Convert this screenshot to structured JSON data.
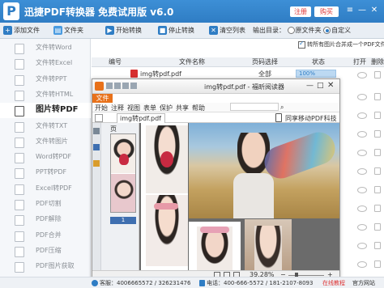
{
  "app": {
    "title": "迅捷PDF转换器 免费试用版 v6.0",
    "logo_letter": "P",
    "register_label": "注册",
    "buy_label": "购买",
    "window_buttons": [
      "≡",
      "—",
      "✕"
    ]
  },
  "toolbar": {
    "add_file": "添加文件",
    "add_folder": "文件夹",
    "start_convert": "开始转换",
    "stop_convert": "停止转换",
    "clear_list": "清空列表",
    "output_label": "输出目录：",
    "option_original": "原文件夹",
    "option_custom": "自定义"
  },
  "sidebar": {
    "items": [
      {
        "label": "文件转Word",
        "active": false
      },
      {
        "label": "文件转Excel",
        "active": false
      },
      {
        "label": "文件转PPT",
        "active": false
      },
      {
        "label": "文件转HTML",
        "active": false
      },
      {
        "label": "图片转PDF",
        "active": true
      },
      {
        "label": "文件转TXT",
        "active": false
      },
      {
        "label": "文件转图片",
        "active": false
      },
      {
        "label": "Word转PDF",
        "active": false
      },
      {
        "label": "PPT转PDF",
        "active": false
      },
      {
        "label": "Excel转PDF",
        "active": false
      },
      {
        "label": "PDF切割",
        "active": false
      },
      {
        "label": "PDF解除",
        "active": false
      },
      {
        "label": "PDF合并",
        "active": false
      },
      {
        "label": "PDF压缩",
        "active": false
      },
      {
        "label": "PDF图片获取",
        "active": false
      }
    ]
  },
  "main": {
    "merge_checkbox": "转所有图片合并成一个PDF文件",
    "columns": [
      "编号",
      "文件名称",
      "页码选择",
      "状态",
      "打开",
      "删除"
    ],
    "rows": [
      {
        "index": "1",
        "filename": "img转pdf.pdf",
        "pages": "全部",
        "status": "100%",
        "progress": 1.0
      }
    ]
  },
  "viewer": {
    "title": "img转pdf.pdf - 福昕阅读器",
    "file_tab": "文件",
    "ribbon_items": [
      "开始",
      "注释",
      "视图",
      "表单",
      "保护",
      "共享",
      "帮助"
    ],
    "doc_tab": "img转pdf.pdf",
    "cloud_label": "同享移动PDF科技",
    "page_label": "页",
    "thumb_page_number": "1",
    "zoom": "39.28%"
  },
  "footer": {
    "qq_label": "客服：",
    "qq1": "4006665572",
    "qq2": "326231476",
    "phone_label": "电话：",
    "phone1": "400-666-5572",
    "phone2": "181-2107-8093",
    "help_label": "在线教程",
    "site_label": "官方网站"
  },
  "colors": {
    "accent": "#2f7dc4",
    "orange": "#e8711a",
    "progress": "#2f7dc4"
  }
}
